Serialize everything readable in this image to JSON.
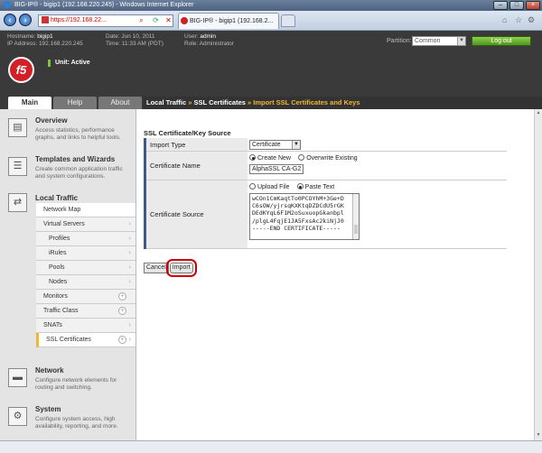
{
  "window": {
    "title": "BIG-IP® - bigip1 (192.168.220.245) - Windows Internet Explorer"
  },
  "browser": {
    "address": "https://192.168.22...",
    "tab_label": "BIG-IP® - bigip1 (192.168.2..."
  },
  "header": {
    "hostname_label": "Hostname:",
    "hostname": "bigip1",
    "ip_label": "IP Address:",
    "ip": "192.168.220.245",
    "date_label": "Date:",
    "date": "Jun 10, 2011",
    "time_label": "Time:",
    "time": "11:33 AM (PDT)",
    "user_label": "User:",
    "user": "admin",
    "role_label": "Role:",
    "role": "Administrator",
    "partition_label": "Partition:",
    "partition_value": "Common",
    "logout": "Log out",
    "logo": "f5",
    "unit_status": "Unit: Active"
  },
  "main_tabs": [
    "Main",
    "Help",
    "About"
  ],
  "sidebar": {
    "overview": {
      "title": "Overview",
      "desc": "Access statistics, performance graphs, and links to helpful tools."
    },
    "templates": {
      "title": "Templates and Wizards",
      "desc": "Create common application traffic and system configurations."
    },
    "local_traffic": {
      "title": "Local Traffic"
    },
    "items": [
      {
        "label": "Network Map"
      },
      {
        "label": "Virtual Servers"
      },
      {
        "label": "Profiles"
      },
      {
        "label": "iRules"
      },
      {
        "label": "Pools"
      },
      {
        "label": "Nodes"
      },
      {
        "label": "Monitors"
      },
      {
        "label": "Traffic Class"
      },
      {
        "label": "SNATs"
      },
      {
        "label": "SSL Certificates"
      }
    ],
    "network": {
      "title": "Network",
      "desc": "Configure network elements for routing and switching."
    },
    "system": {
      "title": "System",
      "desc": "Configure system access, high availability, reporting, and more."
    }
  },
  "breadcrumb": {
    "part1": "Local Traffic",
    "sep": " » ",
    "part2": "SSL Certificates",
    "part3": "Import SSL Certificates and Keys"
  },
  "form": {
    "title": "SSL Certificate/Key Source",
    "import_type_label": "Import Type",
    "import_type_value": "Certificate",
    "cert_name_label": "Certificate Name",
    "create_new": "Create New",
    "overwrite": "Overwrite Existing",
    "cert_name_value": "AlphaSSL CA-G2",
    "cert_source_label": "Certificate Source",
    "upload_file": "Upload File",
    "paste_text": "Paste Text",
    "textarea_lines": "wCOn1CmKaqtTo0PCOYhM+3Ge+D\nC6sOW/yjrsqKXKtqDZDCdU5rGK\nDEdKYqL6F1M2oSuxuopGkanbpl\n/plgL4FqjE1JA5FxsAc2kiNjJ0\n-----END CERTIFICATE-----"
  },
  "buttons": {
    "cancel": "Cancel",
    "import": "Import"
  }
}
